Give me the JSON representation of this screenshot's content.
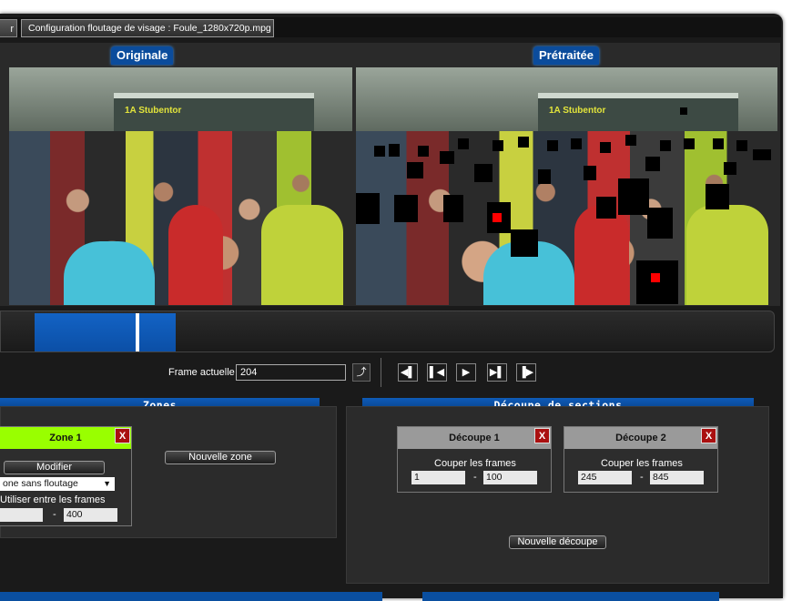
{
  "tabs": {
    "partial_label": "r",
    "main_label": "Configuration floutage de visage : Foule_1280x720p.mpg"
  },
  "video": {
    "original_label": "Originale",
    "processed_label": "Prétraitée",
    "bus_sign": "1A Stubentor"
  },
  "controls": {
    "frame_label": "Frame actuelle",
    "frame_value": "204",
    "goto_icon": "enter-arrow-icon",
    "nav_buttons": [
      "rewind-icon",
      "previous-frame-icon",
      "play-icon",
      "next-frame-icon",
      "fast-forward-icon"
    ]
  },
  "zones": {
    "title": "Zones",
    "zone1": {
      "title": "Zone 1",
      "close": "X",
      "modify": "Modifier",
      "mode": "one sans floutage",
      "range_label": "Utiliser entre les frames",
      "from": "",
      "to": "400",
      "dash": "-"
    },
    "new_zone": "Nouvelle zone"
  },
  "sections": {
    "title": "Découpe de sections",
    "cut1": {
      "title": "Découpe 1",
      "close": "X",
      "label": "Couper les frames",
      "from": "1",
      "to": "100",
      "dash": "-"
    },
    "cut2": {
      "title": "Découpe 2",
      "close": "X",
      "label": "Couper les frames",
      "from": "245",
      "to": "845",
      "dash": "-"
    },
    "new_cut": "Nouvelle découpe"
  },
  "colors": {
    "accent": "#0b4c9c",
    "zone_header": "#99ff00",
    "close_red": "#aa1010"
  }
}
